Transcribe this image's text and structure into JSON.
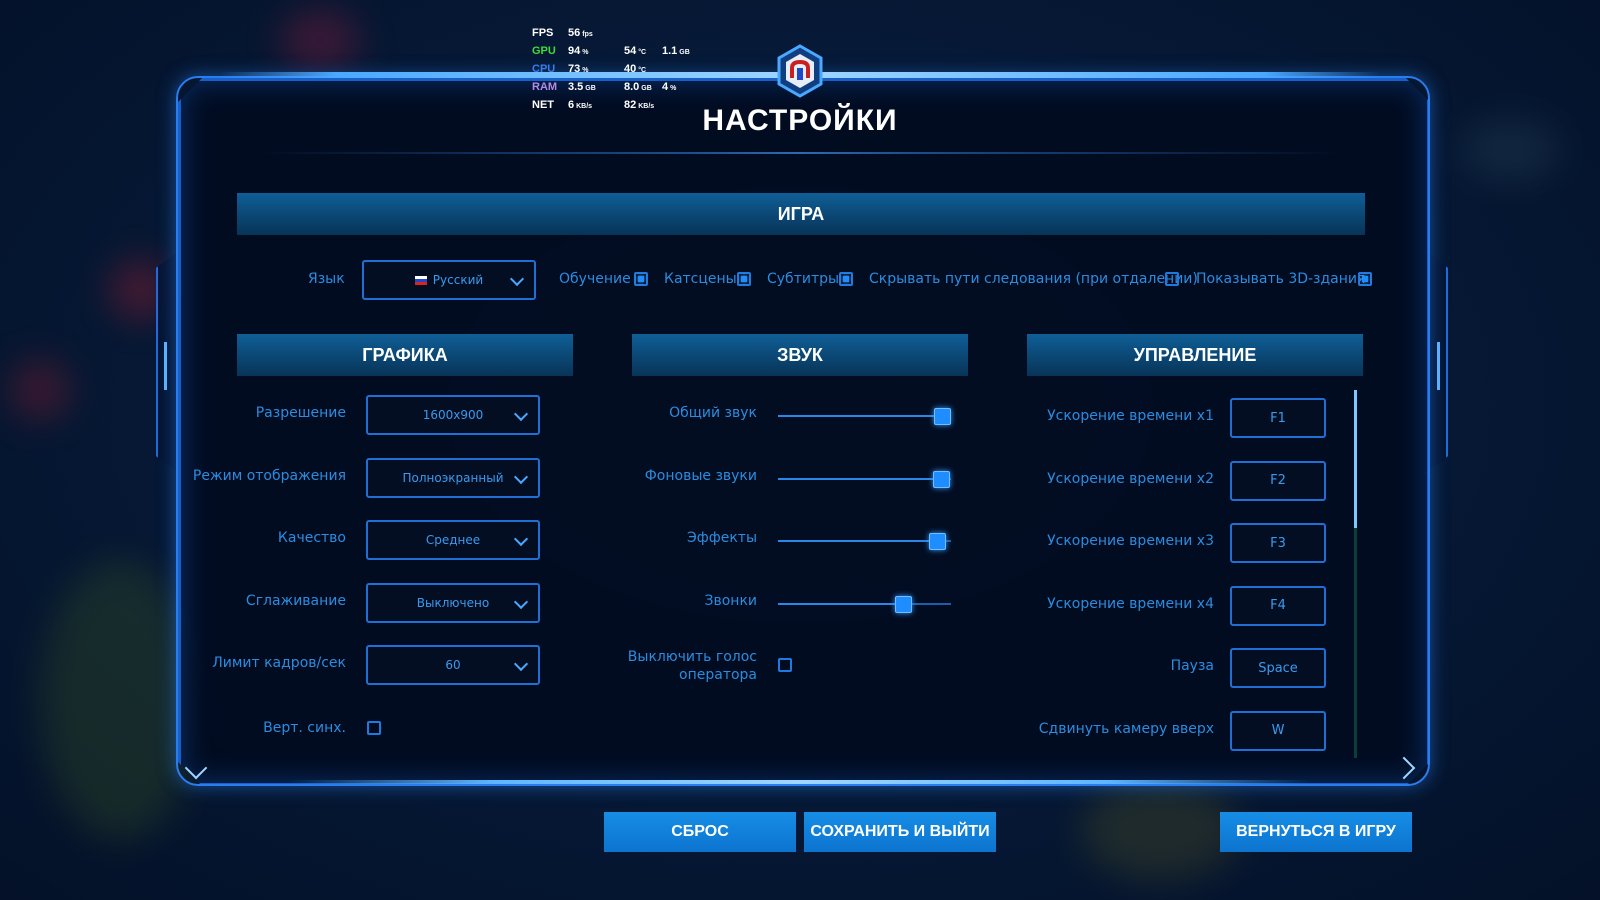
{
  "overlay": {
    "rows": [
      {
        "label": "FPS",
        "label_color": "#ffffff",
        "v1": "56",
        "u1": "fps",
        "v2": "",
        "u2": "",
        "v3": "",
        "u3": ""
      },
      {
        "label": "GPU",
        "label_color": "#3ddc3d",
        "v1": "94",
        "u1": "%",
        "v2": "54",
        "u2": "°C",
        "v3": "1.1",
        "u3": "GB"
      },
      {
        "label": "CPU",
        "label_color": "#3a7cf0",
        "v1": "73",
        "u1": "%",
        "v2": "40",
        "u2": "°C",
        "v3": "",
        "u3": ""
      },
      {
        "label": "RAM",
        "label_color": "#b48ae8",
        "v1": "3.5",
        "u1": "GB",
        "v2": "8.0",
        "u2": "GB",
        "v3": "4",
        "u3": "%"
      },
      {
        "label": "NET",
        "label_color": "#ffffff",
        "v1": "6",
        "u1": "KB/s",
        "v2": "82",
        "u2": "KB/s",
        "v3": "",
        "u3": ""
      }
    ]
  },
  "title": "НАСТРОЙКИ",
  "game": {
    "header": "ИГРА",
    "language_label": "Язык",
    "language_value": "Русский",
    "options": [
      {
        "label": "Обучение",
        "checked": true
      },
      {
        "label": "Катсцены",
        "checked": true
      },
      {
        "label": "Субтитры",
        "checked": true
      },
      {
        "label": "Скрывать пути следования (при отдалении)",
        "checked": false
      },
      {
        "label": "Показывать 3D-здания",
        "checked": true
      }
    ]
  },
  "graphics": {
    "header": "ГРАФИКА",
    "rows": [
      {
        "label": "Разрешение",
        "value": "1600x900"
      },
      {
        "label": "Режим отображения",
        "value": "Полноэкранный"
      },
      {
        "label": "Качество",
        "value": "Среднее"
      },
      {
        "label": "Сглаживание",
        "value": "Выключено"
      },
      {
        "label": "Лимит кадров/сек",
        "value": "60"
      }
    ],
    "vsync_label": "Верт. синх.",
    "vsync_checked": false
  },
  "sound": {
    "header": "ЗВУК",
    "sliders": [
      {
        "label": "Общий звук",
        "level": 0.95
      },
      {
        "label": "Фоновые звуки",
        "level": 0.94
      },
      {
        "label": "Эффекты",
        "level": 0.92
      },
      {
        "label": "Звонки",
        "level": 0.72
      }
    ],
    "mute_operator_line1": "Выключить голос",
    "mute_operator_line2": "оператора",
    "mute_operator_checked": false
  },
  "controls": {
    "header": "УПРАВЛЕНИЕ",
    "bindings": [
      {
        "label": "Ускорение времени x1",
        "key": "F1"
      },
      {
        "label": "Ускорение времени x2",
        "key": "F2"
      },
      {
        "label": "Ускорение времени x3",
        "key": "F3"
      },
      {
        "label": "Ускорение времени x4",
        "key": "F4"
      },
      {
        "label": "Пауза",
        "key": "Space"
      },
      {
        "label": "Сдвинуть камеру вверх",
        "key": "W"
      }
    ]
  },
  "buttons": {
    "reset": "СБРОС",
    "save_exit": "СОХРАНИТЬ И ВЫЙТИ",
    "return": "ВЕРНУТЬСЯ В ИГРУ"
  },
  "colors": {
    "accent": "#1f8cff",
    "button": "#0c74cf",
    "label": "#2b8ce0"
  }
}
